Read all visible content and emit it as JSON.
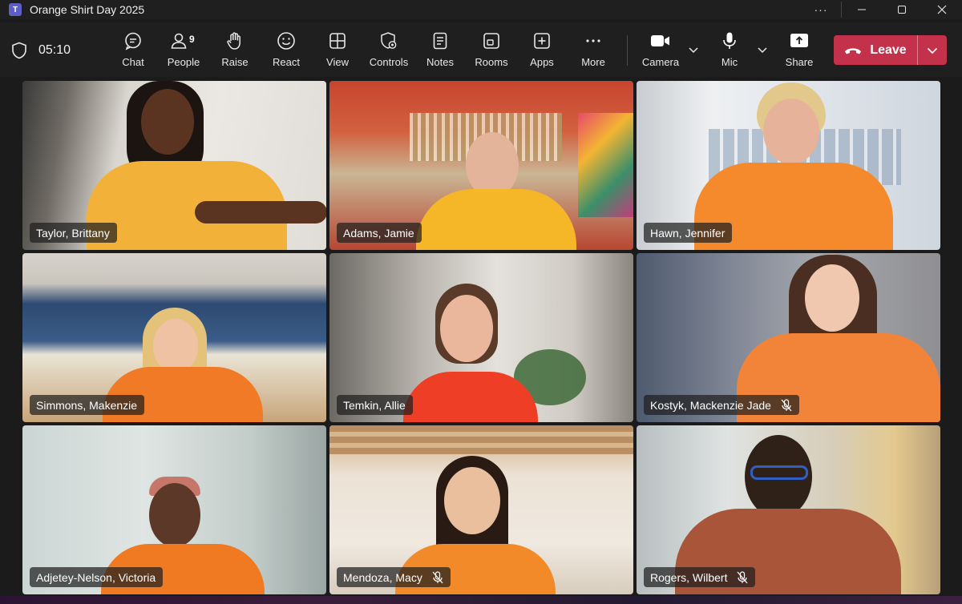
{
  "window": {
    "app_icon": "teams-icon",
    "title": "Orange Shirt Day 2025",
    "more": "···"
  },
  "toolbar": {
    "timer": "05:10",
    "buttons": {
      "chat": "Chat",
      "people": "People",
      "people_count": "9",
      "raise": "Raise",
      "react": "React",
      "view": "View",
      "controls": "Controls",
      "notes": "Notes",
      "rooms": "Rooms",
      "apps": "Apps",
      "more": "More",
      "camera": "Camera",
      "mic": "Mic",
      "share": "Share",
      "leave": "Leave"
    },
    "leave_color": "#c4314b"
  },
  "participants": [
    {
      "name": "Taylor, Brittany",
      "muted": false
    },
    {
      "name": "Adams, Jamie",
      "muted": false
    },
    {
      "name": "Hawn, Jennifer",
      "muted": false
    },
    {
      "name": "Simmons, Makenzie",
      "muted": false
    },
    {
      "name": "Temkin, Allie",
      "muted": false
    },
    {
      "name": "Kostyk, Mackenzie Jade",
      "muted": true
    },
    {
      "name": "Adjetey-Nelson, Victoria",
      "muted": false
    },
    {
      "name": "Mendoza, Macy",
      "muted": true
    },
    {
      "name": "Rogers, Wilbert",
      "muted": true
    }
  ]
}
